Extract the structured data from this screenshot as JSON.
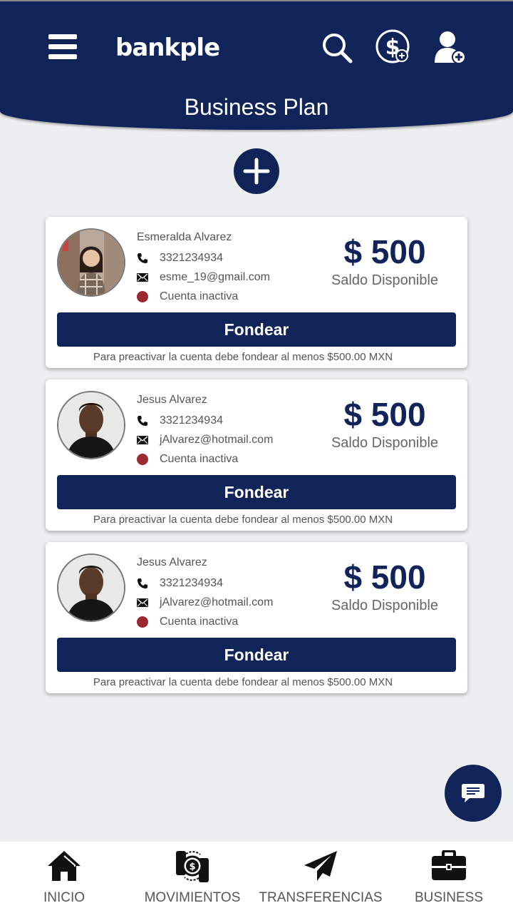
{
  "header": {
    "logo_text": "bankple",
    "title": "Business Plan",
    "color": "#10245a",
    "icons": [
      "menu-icon",
      "search-icon",
      "dollar-add-icon",
      "user-add-icon"
    ]
  },
  "accounts": [
    {
      "name": "Esmeralda Alvarez",
      "phone": "3321234934",
      "email": "esme_19@gmail.com",
      "status": "Cuenta inactiva",
      "amount": "$ 500",
      "amount_label": "Saldo Disponible",
      "button": "Fondear",
      "note": "Para preactivar la cuenta debe fondear al menos $500.00 MXN"
    },
    {
      "name": "Jesus Alvarez",
      "phone": "3321234934",
      "email": "jAlvarez@hotmail.com",
      "status": "Cuenta inactiva",
      "amount": "$ 500",
      "amount_label": "Saldo Disponible",
      "button": "Fondear",
      "note": "Para preactivar la cuenta debe fondear al menos $500.00 MXN"
    },
    {
      "name": "Jesus Alvarez",
      "phone": "3321234934",
      "email": "jAlvarez@hotmail.com",
      "status": "Cuenta inactiva",
      "amount": "$ 500",
      "amount_label": "Saldo Disponible",
      "button": "Fondear",
      "note": "Para preactivar la cuenta debe fondear al menos $500.00 MXN"
    }
  ],
  "status_color": "#9b2a30",
  "nav": [
    {
      "label": "INICIO",
      "icon": "home-icon"
    },
    {
      "label": "MOVIMIENTOS",
      "icon": "money-transfer-icon"
    },
    {
      "label": "TRANSFERENCIAS",
      "icon": "paper-plane-icon"
    },
    {
      "label": "BUSINESS",
      "icon": "briefcase-icon"
    }
  ]
}
